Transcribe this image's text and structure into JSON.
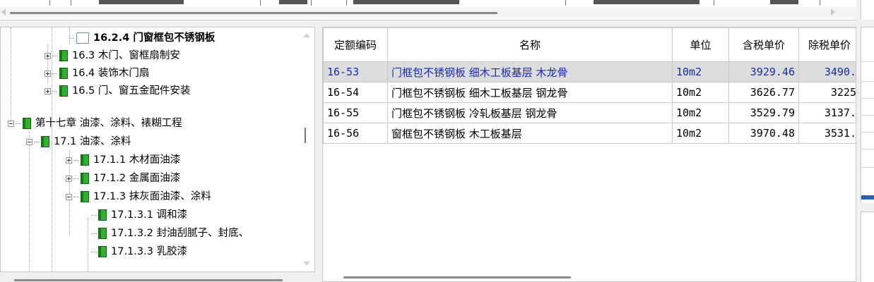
{
  "tree": {
    "items": [
      {
        "label": "16.2.4  门窗框包不锈钢板",
        "icon": "open-book-icon",
        "selected": true
      },
      {
        "label": "16.3  木门、窗框扇制安",
        "icon": "book-icon",
        "expander": "plus"
      },
      {
        "label": "16.4  装饰木门扇",
        "icon": "book-icon",
        "expander": "plus"
      },
      {
        "label": "16.5  门、窗五金配件安装",
        "icon": "book-icon",
        "expander": "plus"
      },
      {
        "label": "第十七章 油漆、涂料、裱糊工程",
        "icon": "book-icon",
        "expander": "minus"
      },
      {
        "label": "17.1  油漆、涂料",
        "icon": "book-icon",
        "expander": "minus"
      },
      {
        "label": "17.1.1  木材面油漆",
        "icon": "book-icon",
        "expander": "plus"
      },
      {
        "label": "17.1.2  金属面油漆",
        "icon": "book-icon",
        "expander": "plus"
      },
      {
        "label": "17.1.3  抹灰面油漆、涂料",
        "icon": "book-icon",
        "expander": "minus"
      },
      {
        "label": "17.1.3.1  调和漆",
        "icon": "book-icon"
      },
      {
        "label": "17.1.3.2  封油刮腻子、封底、",
        "icon": "book-icon"
      },
      {
        "label": "17.1.3.3  乳胶漆",
        "icon": "book-icon"
      }
    ]
  },
  "table": {
    "columns": [
      "定额编码",
      "名称",
      "单位",
      "含税单价",
      "除税单价"
    ],
    "rows": [
      {
        "code": "16-53",
        "name": "门框包不锈钢板 细木工板基层 木龙骨",
        "unit": "10m2",
        "price_tax": "3929.46",
        "price_notax": "3490.",
        "selected": true
      },
      {
        "code": "16-54",
        "name": "门框包不锈钢板 细木工板基层 钢龙骨",
        "unit": "10m2",
        "price_tax": "3626.77",
        "price_notax": "3225"
      },
      {
        "code": "16-55",
        "name": "门框包不锈钢板 冷轧板基层 钢龙骨",
        "unit": "10m2",
        "price_tax": "3529.79",
        "price_notax": "3137."
      },
      {
        "code": "16-56",
        "name": "窗框包不锈钢板 木工板基层",
        "unit": "10m2",
        "price_tax": "3970.48",
        "price_notax": "3531."
      }
    ]
  },
  "colors": {
    "selected_row_text": "#1a2bb0",
    "selected_row_bg": "#dcdcdc",
    "book_green": "#2fb12f"
  }
}
